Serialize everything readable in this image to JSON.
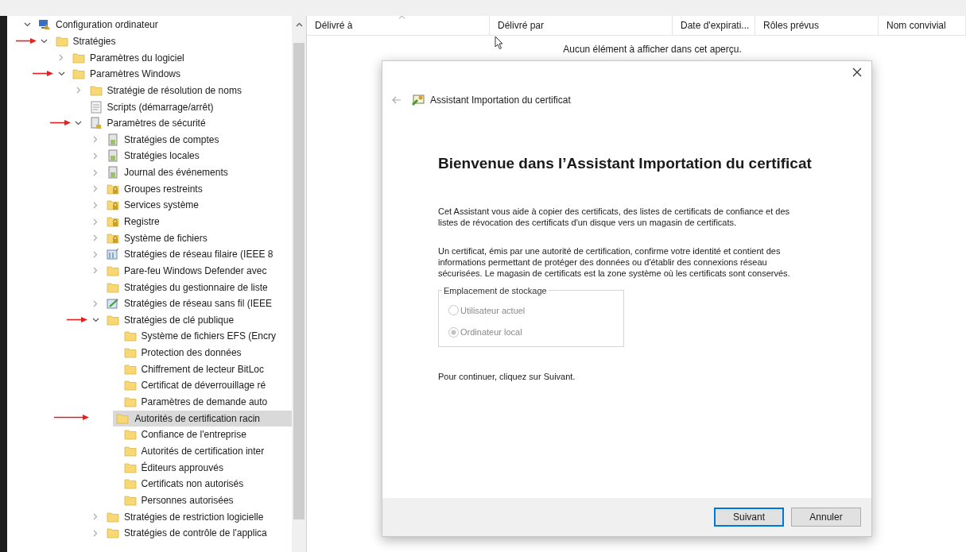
{
  "tree": {
    "items": [
      {
        "label": "Configuration ordinateur",
        "kind": "computer",
        "expanded": true,
        "selected": false,
        "annotated": false,
        "children": [
          {
            "label": "Stratégies",
            "kind": "folder",
            "expanded": true,
            "selected": false,
            "annotated": true,
            "children": [
              {
                "label": "Paramètres du logiciel",
                "kind": "folder",
                "expanded": false,
                "selected": false,
                "annotated": false
              },
              {
                "label": "Paramètres Windows",
                "kind": "folder",
                "expanded": true,
                "selected": false,
                "annotated": true,
                "children": [
                  {
                    "label": "Stratégie de résolution de noms",
                    "kind": "folder",
                    "expanded": false,
                    "selected": false,
                    "annotated": false
                  },
                  {
                    "label": "Scripts (démarrage/arrêt)",
                    "kind": "script",
                    "selected": false,
                    "annotated": false
                  },
                  {
                    "label": "Paramètres de sécurité",
                    "kind": "security",
                    "expanded": true,
                    "selected": false,
                    "annotated": true,
                    "children": [
                      {
                        "label": "Stratégies de comptes",
                        "kind": "policy",
                        "expanded": false,
                        "selected": false,
                        "annotated": false
                      },
                      {
                        "label": "Stratégies locales",
                        "kind": "policy",
                        "expanded": false,
                        "selected": false,
                        "annotated": false
                      },
                      {
                        "label": "Journal des événements",
                        "kind": "policy",
                        "expanded": false,
                        "selected": false,
                        "annotated": false
                      },
                      {
                        "label": "Groupes restreints",
                        "kind": "lockfolder",
                        "expanded": false,
                        "selected": false,
                        "annotated": false
                      },
                      {
                        "label": "Services système",
                        "kind": "lockfolder",
                        "expanded": false,
                        "selected": false,
                        "annotated": false
                      },
                      {
                        "label": "Registre",
                        "kind": "lockfolder",
                        "expanded": false,
                        "selected": false,
                        "annotated": false
                      },
                      {
                        "label": "Système de fichiers",
                        "kind": "lockfolder",
                        "expanded": false,
                        "selected": false,
                        "annotated": false
                      },
                      {
                        "label": "Stratégies de réseau filaire (IEEE 8",
                        "kind": "network",
                        "expanded": false,
                        "selected": false,
                        "annotated": false
                      },
                      {
                        "label": "Pare-feu Windows Defender avec",
                        "kind": "folder",
                        "expanded": false,
                        "selected": false,
                        "annotated": false
                      },
                      {
                        "label": "Stratégies du gestionnaire de liste",
                        "kind": "folder",
                        "selected": false,
                        "annotated": false
                      },
                      {
                        "label": "Stratégies de réseau sans fil (IEEE",
                        "kind": "wireless",
                        "expanded": false,
                        "selected": false,
                        "annotated": false
                      },
                      {
                        "label": "Stratégies de clé publique",
                        "kind": "folder",
                        "expanded": true,
                        "selected": false,
                        "annotated": true,
                        "children": [
                          {
                            "label": "Système de fichiers EFS (Encry",
                            "kind": "folder",
                            "selected": false,
                            "annotated": false
                          },
                          {
                            "label": "Protection des données",
                            "kind": "folder",
                            "selected": false,
                            "annotated": false
                          },
                          {
                            "label": "Chiffrement de lecteur BitLoc",
                            "kind": "folder",
                            "selected": false,
                            "annotated": false
                          },
                          {
                            "label": "Certificat de déverrouillage ré",
                            "kind": "folder",
                            "selected": false,
                            "annotated": false
                          },
                          {
                            "label": "Paramètres de demande auto",
                            "kind": "folder",
                            "selected": false,
                            "annotated": false
                          },
                          {
                            "label": "Autorités de certification racin",
                            "kind": "folder",
                            "selected": true,
                            "annotated": true
                          },
                          {
                            "label": "Confiance de l'entreprise",
                            "kind": "folder",
                            "selected": false,
                            "annotated": false
                          },
                          {
                            "label": "Autorités de certification inter",
                            "kind": "folder",
                            "selected": false,
                            "annotated": false
                          },
                          {
                            "label": "Éditeurs approuvés",
                            "kind": "folder",
                            "selected": false,
                            "annotated": false
                          },
                          {
                            "label": "Certificats non autorisés",
                            "kind": "folder",
                            "selected": false,
                            "annotated": false
                          },
                          {
                            "label": "Personnes autorisées",
                            "kind": "folder",
                            "selected": false,
                            "annotated": false
                          }
                        ]
                      },
                      {
                        "label": "Stratégies de restriction logicielle",
                        "kind": "folder",
                        "expanded": false,
                        "selected": false,
                        "annotated": false
                      },
                      {
                        "label": "Stratégies de contrôle de l'applica",
                        "kind": "folder",
                        "expanded": false,
                        "selected": false,
                        "annotated": false
                      }
                    ]
                  }
                ]
              }
            ]
          }
        ]
      }
    ]
  },
  "list": {
    "columns": [
      {
        "label": "Délivré à",
        "sorted": true
      },
      {
        "label": "Délivré par",
        "sorted": false
      },
      {
        "label": "Date d'expirati...",
        "sorted": false
      },
      {
        "label": "Rôles prévus",
        "sorted": false
      },
      {
        "label": "Nom convivial",
        "sorted": false
      }
    ],
    "empty_message": "Aucun élément à afficher dans cet aperçu."
  },
  "dialog": {
    "title": "Assistant Importation du certificat",
    "heading": "Bienvenue dans l’Assistant Importation du certificat",
    "paragraphs": [
      "Cet Assistant vous aide à copier des certificats, des listes de certificats de confiance et des listes de révocation des certificats d'un disque vers un magasin de certificats.",
      "Un certificat, émis par une autorité de certification, confirme votre identité et contient des informations permettant de protéger des données ou d'établir des connexions réseau sécurisées. Le magasin de certificats est la zone système où les certificats sont conservés."
    ],
    "storage": {
      "legend": "Emplacement de stockage",
      "options": [
        {
          "label": "Utilisateur actuel",
          "selected": false,
          "disabled": true
        },
        {
          "label": "Ordinateur local",
          "selected": true,
          "disabled": true
        }
      ]
    },
    "hint": "Pour continuer, cliquez sur Suivant.",
    "buttons": [
      {
        "label": "Suivant",
        "default": true
      },
      {
        "label": "Annuler",
        "default": false
      }
    ]
  }
}
